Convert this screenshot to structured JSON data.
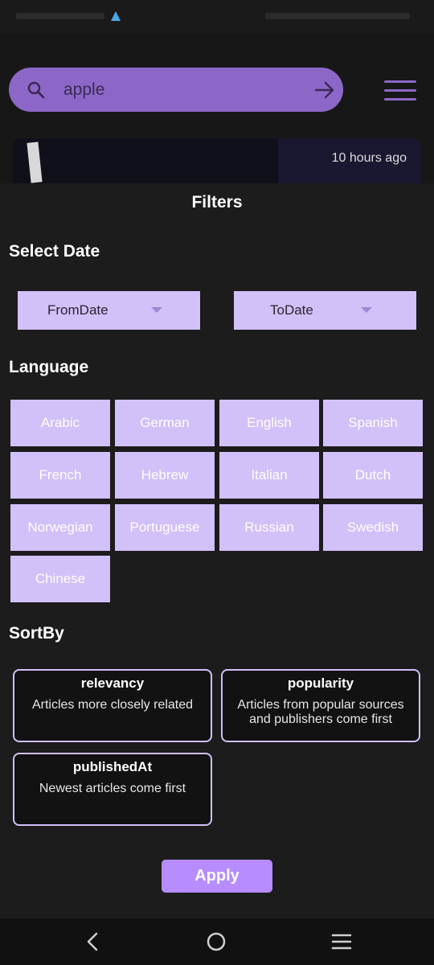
{
  "search": {
    "value": "apple",
    "placeholder": ""
  },
  "news_card": {
    "time": "10 hours ago"
  },
  "filters": {
    "title": "Filters",
    "select_date_label": "Select Date",
    "from_date": "FromDate",
    "to_date": "ToDate",
    "language_label": "Language",
    "languages": [
      "Arabic",
      "German",
      "English",
      "Spanish",
      "French",
      "Hebrew",
      "Italian",
      "Dutch",
      "Norwegian",
      "Portuguese",
      "Russian",
      "Swedish",
      "Chinese"
    ],
    "sortby_label": "SortBy",
    "sort_options": [
      {
        "name": "relevancy",
        "desc": "Articles more closely related"
      },
      {
        "name": "popularity",
        "desc": "Articles from popular sources and publishers come first"
      },
      {
        "name": "publishedAt",
        "desc": "Newest articles come first"
      }
    ],
    "apply_label": "Apply"
  },
  "colors": {
    "accent": "#8d67c8",
    "chip": "#d2c0f8",
    "apply": "#b68cff",
    "background": "#1c1c1c"
  }
}
